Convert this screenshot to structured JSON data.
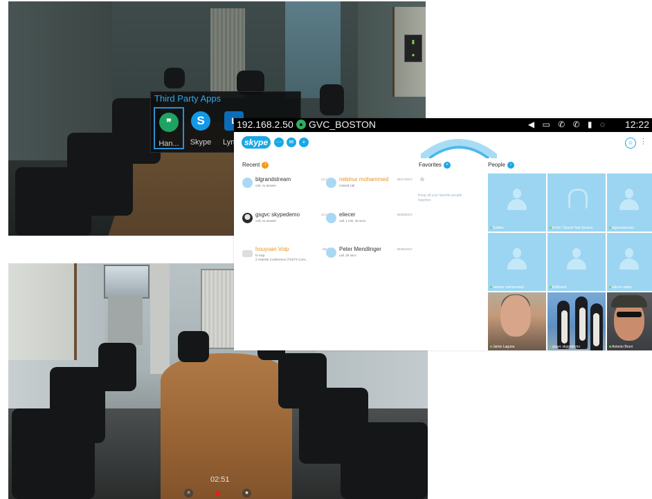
{
  "apps_popup": {
    "title": "Third Party Apps",
    "apps": [
      {
        "label": "Han...",
        "icon": "hangouts-icon",
        "glyph": "❞",
        "selected": true
      },
      {
        "label": "Skype",
        "icon": "skype-icon",
        "glyph": "S"
      },
      {
        "label": "Lync...",
        "icon": "lync-icon",
        "glyph": "L"
      }
    ]
  },
  "status_bar": {
    "ip": "192.168.2.50",
    "account": "GVC_BOSTON",
    "icons": "◀ ▭ ✆ ✆ ▮ ◌",
    "time": "12:22"
  },
  "skype": {
    "logo": "skype",
    "recent_label": "Recent",
    "favorites_label": "Favorites",
    "people_label": "People",
    "fav_hint": "Keep all your favorite people together.",
    "recent": [
      {
        "name": "blgrandstream",
        "sub": "call, no answer",
        "time": "14:14",
        "color": "normal"
      },
      {
        "name": "nebinur mohammed",
        "sub": "missed call",
        "time": "06/17/2017",
        "color": "orange"
      },
      {
        "name": "gsgvc skypedemo",
        "sub": "call, no answer",
        "time": "14:13",
        "color": "normal",
        "avatar": "photo"
      },
      {
        "name": "eliecer",
        "sub": "call, 1 min, 46 secs",
        "time": "05/30/2017",
        "color": "normal"
      },
      {
        "name": "houyuan Voip",
        "sub": "hi Voip",
        "sub2": "2 Asterisk Conference (TX)/TX Cont...",
        "time": "Wed",
        "color": "orange",
        "avatar": "device"
      },
      {
        "name": "Peter Mendlinger",
        "sub": "call, 28 secs",
        "time": "05/05/2017",
        "color": "normal"
      }
    ],
    "people": [
      {
        "name": "Galileo",
        "type": "placeholder"
      },
      {
        "name": "Echo / Sound Test Service",
        "type": "headset"
      },
      {
        "name": "blgrandstream",
        "type": "placeholder"
      },
      {
        "name": "nebinur mohammed",
        "type": "placeholder"
      },
      {
        "name": "ElliBoard",
        "type": "placeholder"
      },
      {
        "name": "eliecer adam",
        "type": "placeholder"
      },
      {
        "name": "Jaime Laguna",
        "type": "photo1"
      },
      {
        "name": "gsgvc skypedemo",
        "type": "photo2"
      },
      {
        "name": "Antonio Bruni",
        "type": "photo3"
      }
    ]
  },
  "video_call": {
    "timer": "02:51",
    "logo": "skype",
    "controls": [
      {
        "name": "end-call-button",
        "glyph": "✕"
      },
      {
        "name": "video-toggle-button",
        "glyph": "■"
      }
    ]
  }
}
